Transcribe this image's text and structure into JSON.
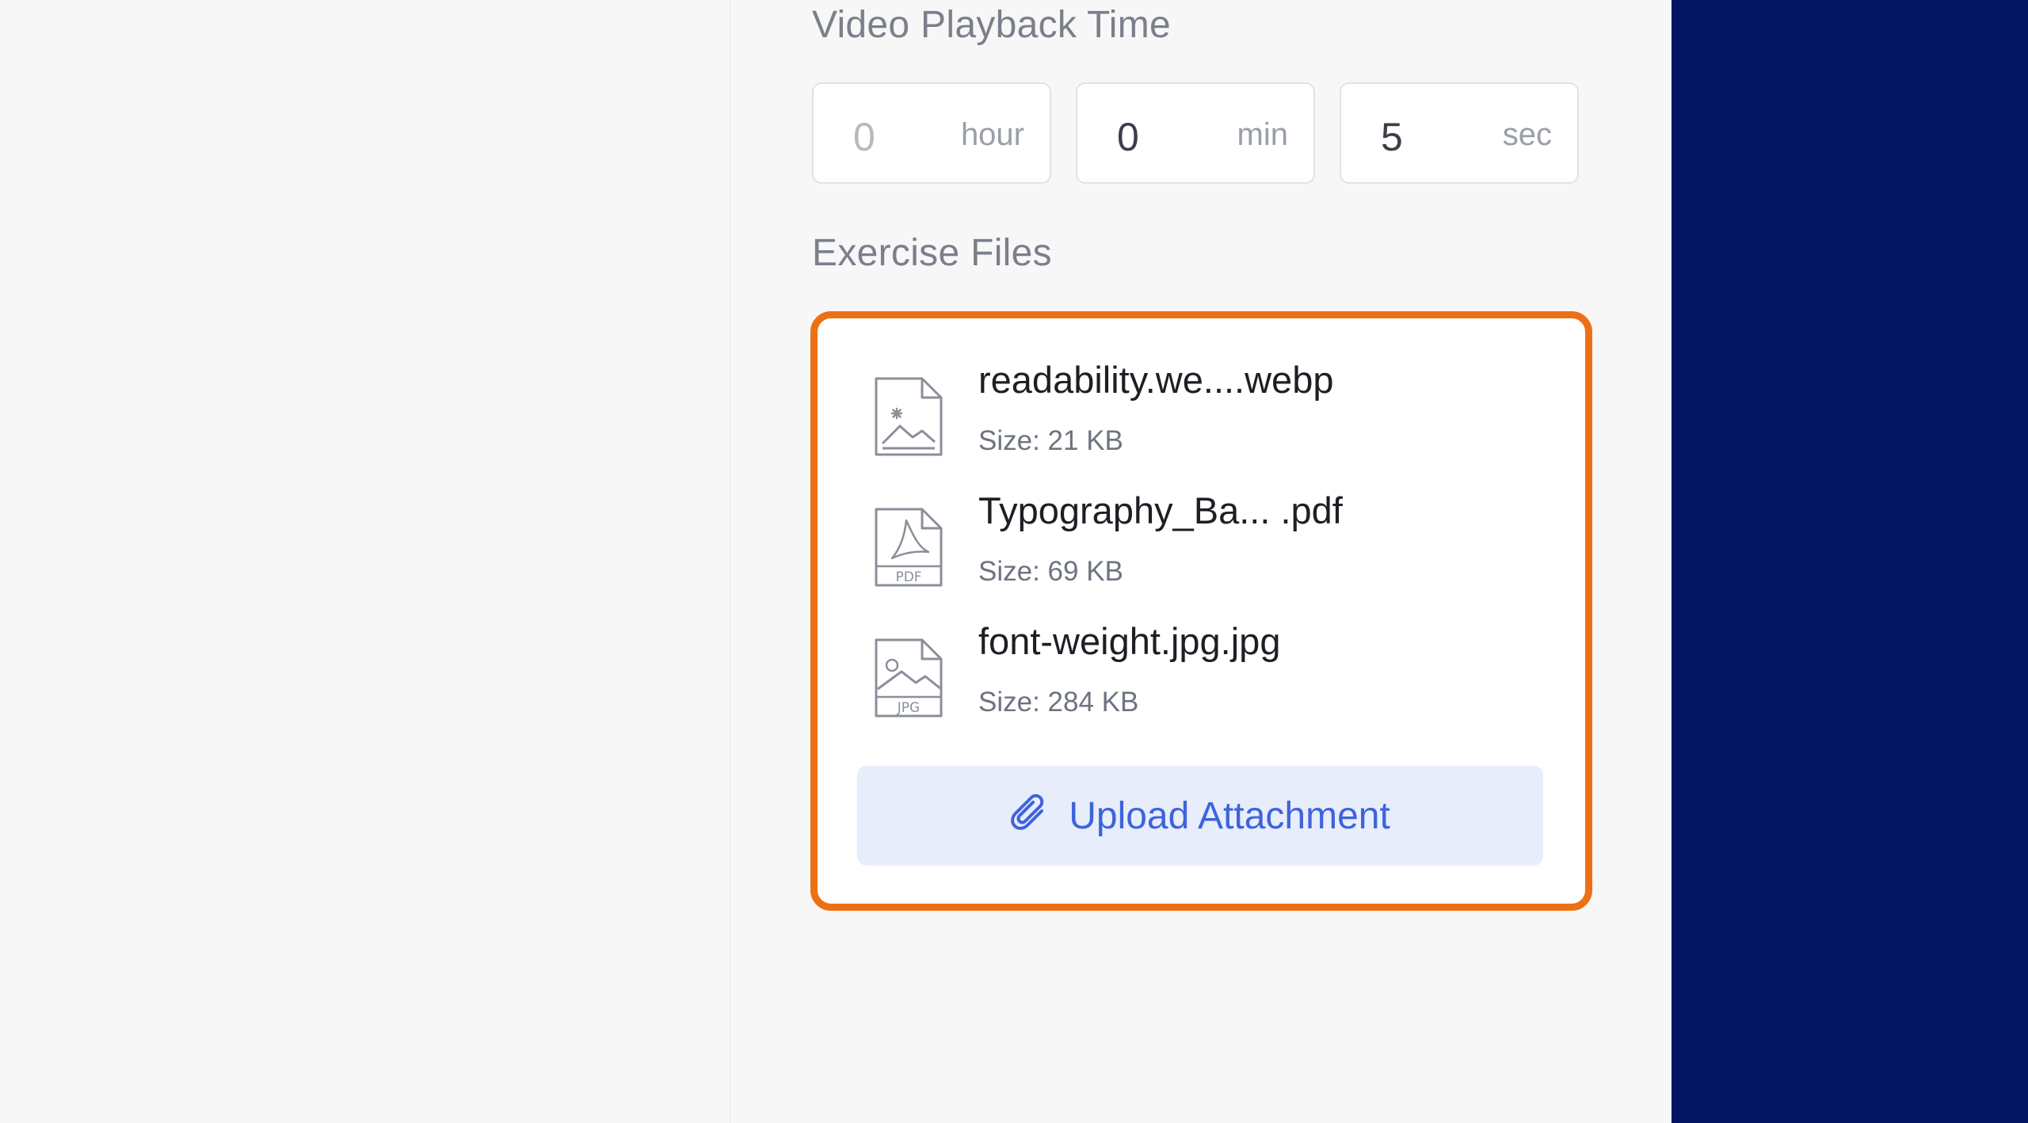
{
  "playback": {
    "label": "Video Playback Time",
    "hour": {
      "value": "0",
      "unit": "hour"
    },
    "min": {
      "value": "0",
      "unit": "min"
    },
    "sec": {
      "value": "5",
      "unit": "sec"
    }
  },
  "exercise": {
    "label": "Exercise Files",
    "files": [
      {
        "name": "readability.we....webp",
        "size": "Size: 21 KB",
        "icon": "image-file-icon"
      },
      {
        "name": "Typography_Ba... .pdf",
        "size": "Size: 69 KB",
        "icon": "pdf-file-icon",
        "icon_text": "PDF"
      },
      {
        "name": "font-weight.jpg.jpg",
        "size": "Size: 284 KB",
        "icon": "jpg-file-icon",
        "icon_text": "JPG"
      }
    ],
    "upload_label": "Upload Attachment"
  },
  "colors": {
    "highlight_border": "#ee7015",
    "button_bg": "#e8edfb",
    "button_text": "#3e63dd",
    "sidebar_dark": "#011562"
  }
}
